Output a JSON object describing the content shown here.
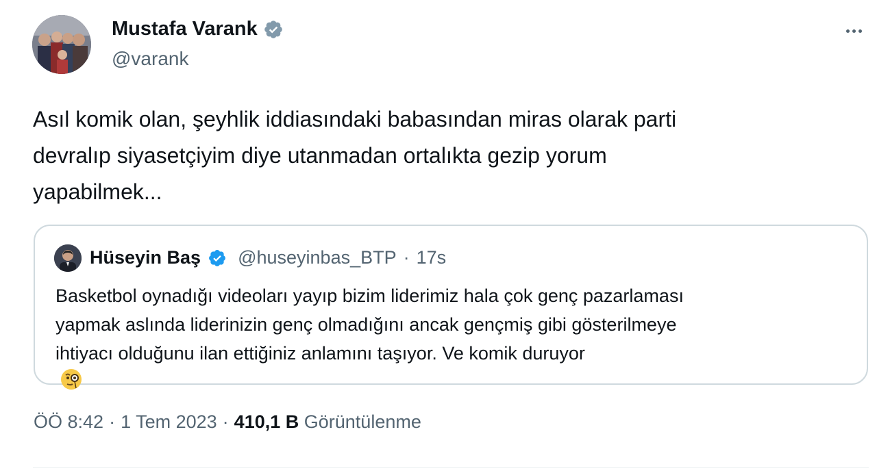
{
  "author": {
    "name": "Mustafa Varank",
    "handle": "@varank",
    "verified": true,
    "verified_color": "#829aab"
  },
  "more_icon": "more-horizontal-icon",
  "tweet": {
    "lines": [
      "Asıl komik olan, şeyhlik iddiasındaki babasından miras olarak parti",
      "devralıp siyasetçiyim diye utanmadan ortalıkta gezip yorum",
      "yapabilmek..."
    ]
  },
  "quote": {
    "name": "Hüseyin Baş",
    "verified": true,
    "verified_color": "#1d9bf0",
    "handle": "@huseyinbas_BTP",
    "separator": "·",
    "time": "17s",
    "lines": [
      "Basketbol oynadığı videoları yayıp bizim liderimiz hala çok genç pazarlaması",
      "yapmak aslında liderinizin genç olmadığını ancak gençmiş gibi gösterilmeye",
      "ihtiyacı olduğunu ilan ettiğiniz anlamını taşıyor. Ve komik duruyor"
    ],
    "emoji": "face-with-monocle-icon"
  },
  "meta": {
    "time": "ÖÖ 8:42",
    "sep1": "·",
    "date": "1 Tem 2023",
    "sep2": "·",
    "views_count": "410,1 B",
    "views_label": "Görüntülenme"
  },
  "colors": {
    "text": "#0f1419",
    "secondary": "#536471",
    "border": "#cfd9de"
  }
}
